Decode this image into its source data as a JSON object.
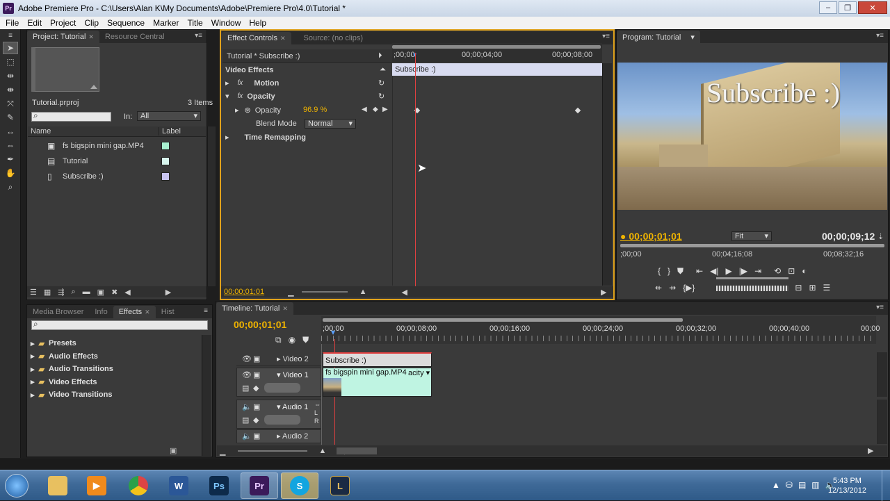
{
  "window": {
    "title": "Adobe Premiere Pro - C:\\Users\\Alan K\\My Documents\\Adobe\\Premiere Pro\\4.0\\Tutorial *",
    "app_icon": "Pr"
  },
  "menu": [
    "File",
    "Edit",
    "Project",
    "Clip",
    "Sequence",
    "Marker",
    "Title",
    "Window",
    "Help"
  ],
  "project": {
    "tabs": [
      "Project: Tutorial",
      "Resource Central"
    ],
    "file_name": "Tutorial.prproj",
    "items_count": "3 Items",
    "in_label": "In:",
    "in_value": "All",
    "col_name": "Name",
    "col_label": "Label",
    "items": [
      {
        "name": "fs bigspin mini gap.MP4",
        "icon": "video-clip-icon",
        "color": "#a8f0d0"
      },
      {
        "name": "Tutorial",
        "icon": "sequence-icon",
        "color": "#d8f6ee"
      },
      {
        "name": "Subscribe :)",
        "icon": "title-icon",
        "color": "#c8c4f0"
      }
    ]
  },
  "effect_controls": {
    "tabs": [
      "Effect Controls",
      "Source: (no clips)"
    ],
    "clip_title": "Tutorial * Subscribe :)",
    "section": "Video Effects",
    "motion": "Motion",
    "opacity_group": "Opacity",
    "opacity_label": "Opacity",
    "opacity_value": "96.9 %",
    "blend_label": "Blend Mode",
    "blend_value": "Normal",
    "time_remap": "Time Remapping",
    "ruler": [
      ";00;00",
      "00;00;04;00",
      "00;00;08;00"
    ],
    "clip_bar": "Subscribe :)",
    "timecode": "00;00;01;01"
  },
  "program": {
    "tab": "Program: Tutorial",
    "overlay_text": "Subscribe :)",
    "current_time": "00;00;01;01",
    "fit": "Fit",
    "duration": "00;00;09;12",
    "ruler": [
      ";00;00",
      "00;04;16;08",
      "00;08;32;16"
    ]
  },
  "effects_panel": {
    "tabs": [
      "Media Browser",
      "Info",
      "Effects",
      "Hist"
    ],
    "folders": [
      "Presets",
      "Audio Effects",
      "Audio Transitions",
      "Video Effects",
      "Video Transitions"
    ]
  },
  "timeline": {
    "tab": "Timeline: Tutorial",
    "timecode": "00;00;01;01",
    "ruler": [
      ";00;00",
      "00;00;08;00",
      "00;00;16;00",
      "00;00;24;00",
      "00;00;32;00",
      "00;00;40;00",
      "00;00"
    ],
    "tracks": [
      "Video 2",
      "Video 1",
      "Audio 1",
      "Audio 2"
    ],
    "clip_title": "Subscribe :)",
    "clip_video": "fs bigspin mini gap.MP4",
    "clip_video_fx": "acity"
  },
  "taskbar": {
    "apps": [
      {
        "name": "explorer",
        "label": "",
        "color": "#e8c060"
      },
      {
        "name": "media-player",
        "label": "▶",
        "color": "#f08a1c"
      },
      {
        "name": "chrome",
        "label": "",
        "color": "#d44"
      },
      {
        "name": "word",
        "label": "W",
        "color": "#2b5797"
      },
      {
        "name": "photoshop",
        "label": "Ps",
        "color": "#0d2a4a"
      },
      {
        "name": "premiere",
        "label": "Pr",
        "color": "#3b1a5a"
      },
      {
        "name": "skype",
        "label": "S",
        "color": "#12a5e0"
      },
      {
        "name": "league",
        "label": "L",
        "color": "#1a2a44"
      }
    ],
    "time": "5:43 PM",
    "date": "12/13/2012"
  }
}
